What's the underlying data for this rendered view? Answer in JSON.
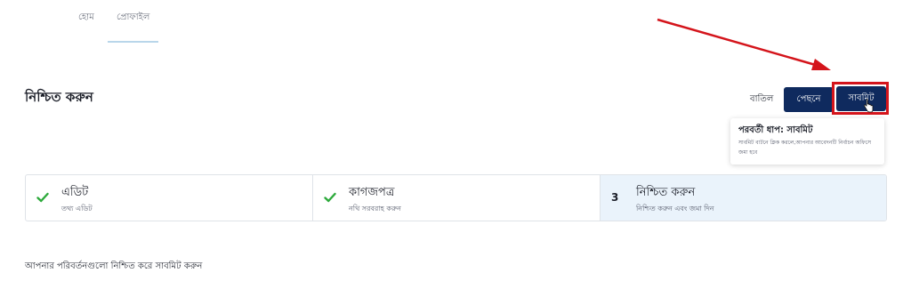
{
  "nav": {
    "tabs": [
      {
        "label": "হোম"
      },
      {
        "label": "প্রোফাইল"
      }
    ]
  },
  "page": {
    "title": "নিশ্চিত করুন"
  },
  "actions": {
    "cancel_label": "বাতিল",
    "back_label": "পেছনে",
    "submit_label": "সাবমিট"
  },
  "tooltip": {
    "title": "পরবর্তী ধাপ: সাবমিট",
    "body": "সাবমিট বাটনে ক্লিক করলে,আপনার আবেদনটি নির্বাচন অফিসে জমা হবে"
  },
  "stepper": {
    "steps": [
      {
        "title": "এডিট",
        "subtitle": "তথ্য এডিট",
        "status": "complete",
        "icon": "check-icon"
      },
      {
        "title": "কাগজপত্র",
        "subtitle": "নথি সরবরাহ করুন",
        "status": "complete",
        "icon": "check-icon"
      },
      {
        "number": "3",
        "title": "নিশ্চিত করুন",
        "subtitle": "নিশ্চিত করুন এবং জমা দিন",
        "status": "current"
      }
    ]
  },
  "footer": {
    "instruction": "আপনার পরিবর্তনগুলো নিশ্চিত করে সাবমিট করুন"
  },
  "colors": {
    "primary": "#0f2a5e",
    "highlight": "#d4141b",
    "check": "#2eaa3c",
    "active_step_bg": "#eaf3fb"
  }
}
